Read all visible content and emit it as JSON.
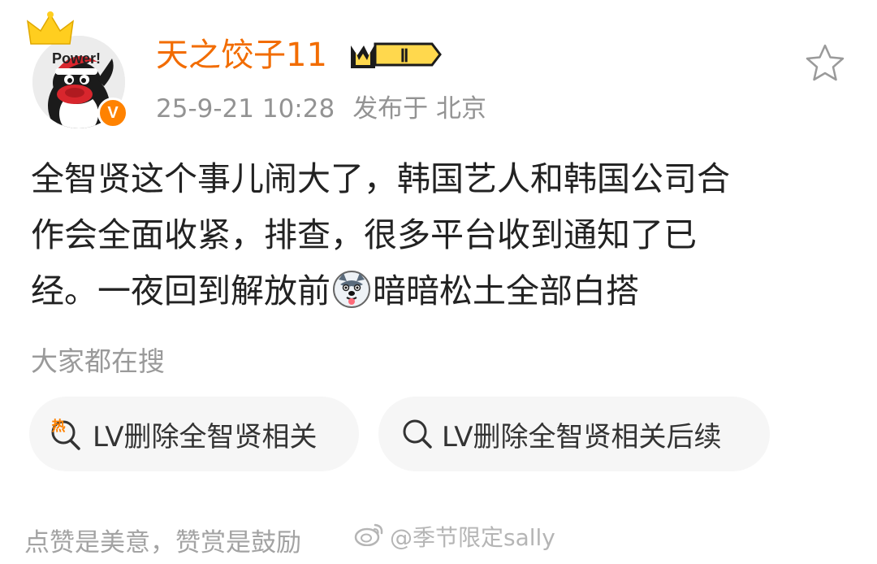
{
  "post": {
    "user": {
      "avatar_text": "Power!",
      "verified_mark": "V",
      "name": "天之饺子11",
      "level": "Ⅱ"
    },
    "meta": {
      "date": "25-9-21 10:28",
      "location": "发布于 北京"
    },
    "content": {
      "line1": "全智贤这个事儿闹大了，韩国艺人和韩国公司合",
      "line2": "作会全面收紧，排查，很多平台收到通知了已",
      "line3_before": "经。一夜回到解放前",
      "line3_after": "暗暗松土全部白搭",
      "emoji": "husky-dog-emoji"
    }
  },
  "search": {
    "heading": "大家都在搜",
    "chips": [
      {
        "label": "LV删除全智贤相关",
        "icon": "hot-search-icon",
        "icon_text": "热"
      },
      {
        "label": "LV删除全智贤相关后续",
        "icon": "search-icon"
      }
    ]
  },
  "footer": {
    "text": "点赞是美意，赞赏是鼓励",
    "watermark": "@季节限定sally"
  },
  "colors": {
    "username": "#f26c00",
    "verified": "#ff8200",
    "meta": "#939393",
    "chip_bg": "#f6f6f6",
    "hot_icon": "#ff8200"
  }
}
